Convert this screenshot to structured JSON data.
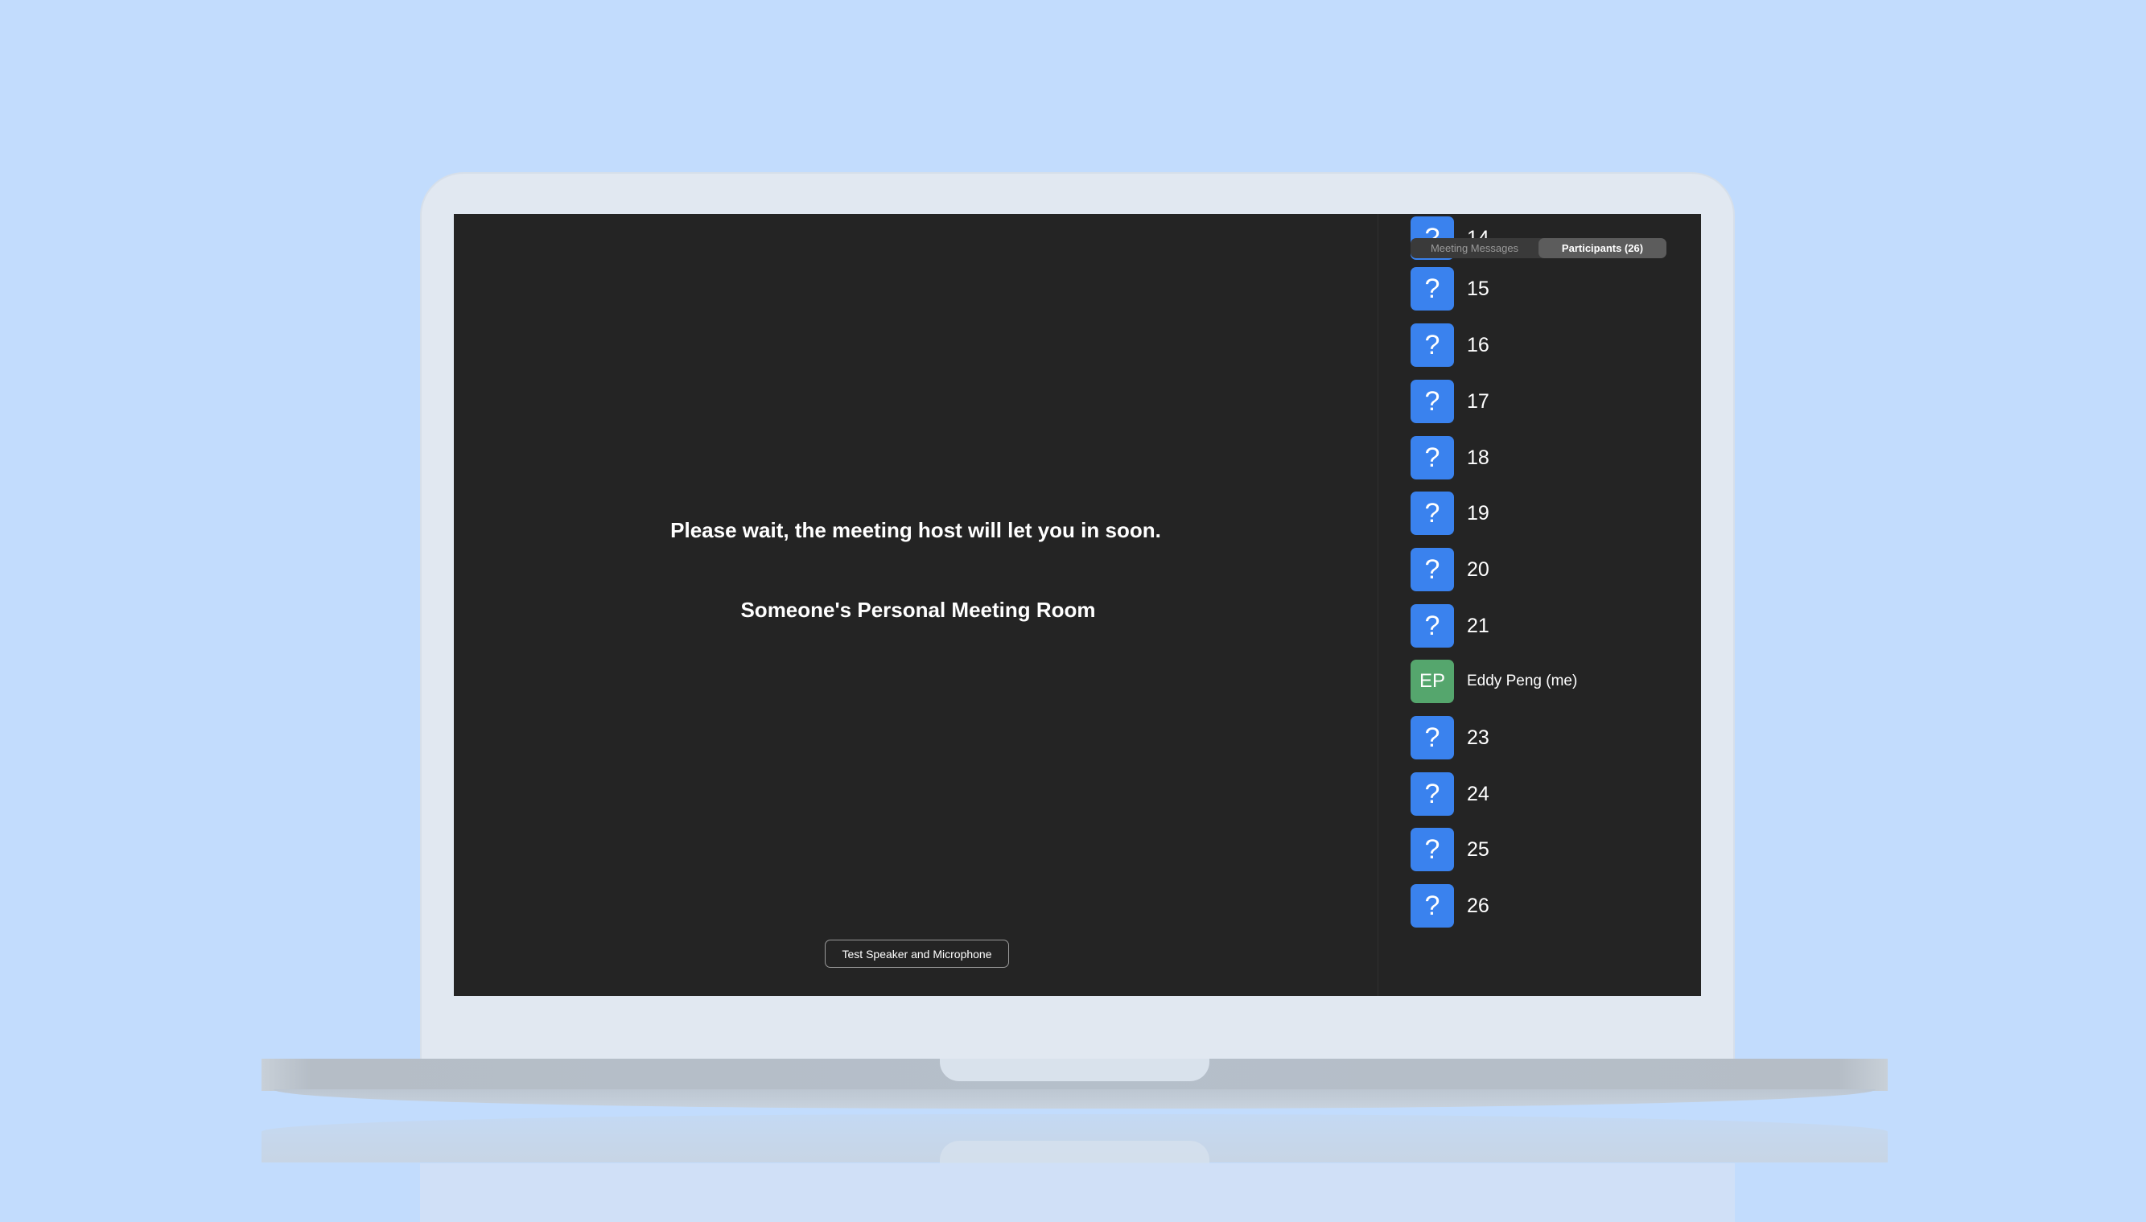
{
  "main": {
    "wait_message": "Please wait, the meeting host will let you in soon.",
    "room_name": "Someone's Personal Meeting Room",
    "test_button_label": "Test Speaker and Microphone"
  },
  "sidebar": {
    "tabs": [
      {
        "label": "Meeting Messages",
        "active": false
      },
      {
        "label": "Participants (26)",
        "active": true
      }
    ],
    "participants": [
      {
        "avatar": "?",
        "name": "14"
      },
      {
        "avatar": "?",
        "name": "15"
      },
      {
        "avatar": "?",
        "name": "16"
      },
      {
        "avatar": "?",
        "name": "17"
      },
      {
        "avatar": "?",
        "name": "18"
      },
      {
        "avatar": "?",
        "name": "19"
      },
      {
        "avatar": "?",
        "name": "20"
      },
      {
        "avatar": "?",
        "name": "21"
      },
      {
        "avatar": "EP",
        "name": "Eddy Peng (me)"
      },
      {
        "avatar": "?",
        "name": "23"
      },
      {
        "avatar": "?",
        "name": "24"
      },
      {
        "avatar": "?",
        "name": "25"
      },
      {
        "avatar": "?",
        "name": "26"
      }
    ]
  },
  "colors": {
    "background": "#c2dcfd",
    "screen": "#242424",
    "avatar_unknown": "#3a82ee",
    "avatar_initials": "#55a66d"
  }
}
